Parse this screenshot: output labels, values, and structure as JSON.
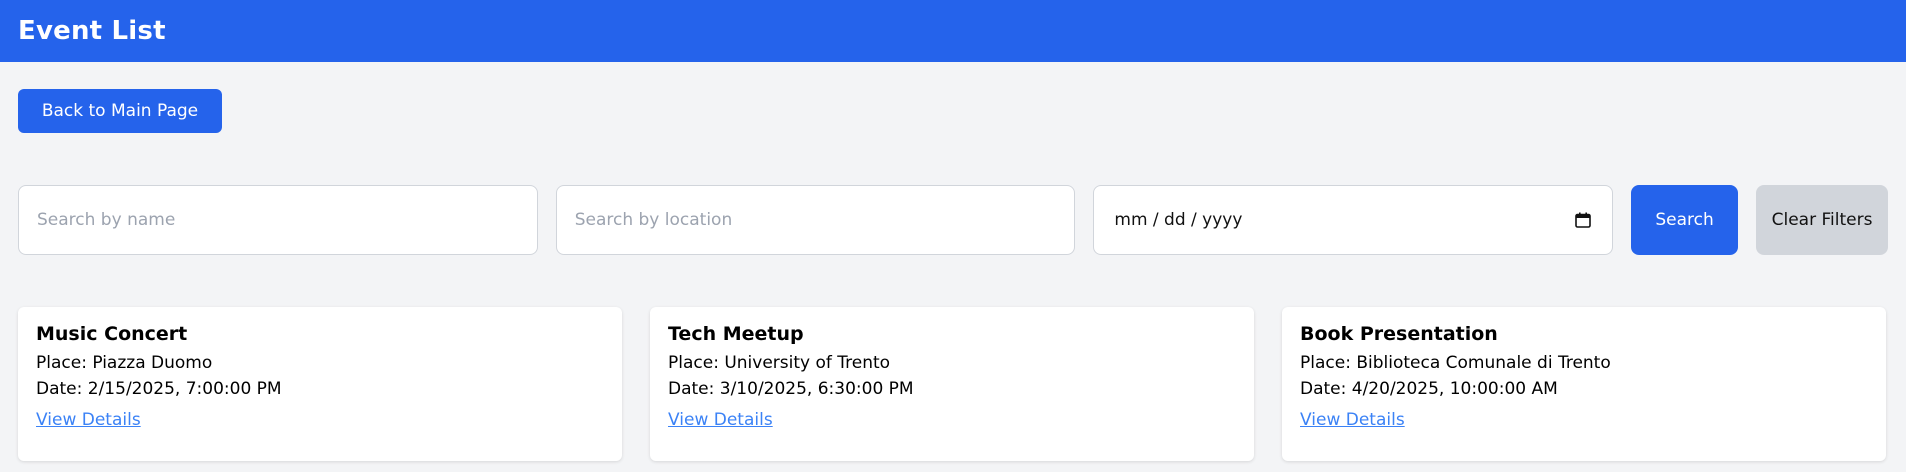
{
  "header": {
    "title": "Event List"
  },
  "nav": {
    "back_label": "Back to Main Page"
  },
  "filters": {
    "name_placeholder": "Search by name",
    "location_placeholder": "Search by location",
    "date_placeholder": "mm / dd / yyyy",
    "search_label": "Search",
    "clear_label": "Clear Filters"
  },
  "events": [
    {
      "title": "Music Concert",
      "place": "Place: Piazza Duomo",
      "date": "Date: 2/15/2025, 7:00:00 PM",
      "link": "View Details"
    },
    {
      "title": "Tech Meetup",
      "place": "Place: University of Trento",
      "date": "Date: 3/10/2025, 6:30:00 PM",
      "link": "View Details"
    },
    {
      "title": "Book Presentation",
      "place": "Place: Biblioteca Comunale di Trento",
      "date": "Date: 4/20/2025, 10:00:00 AM",
      "link": "View Details"
    }
  ],
  "colors": {
    "primary": "#2563eb",
    "background": "#f3f4f6",
    "secondary_button": "#d1d5db",
    "link": "#3b82f6"
  }
}
